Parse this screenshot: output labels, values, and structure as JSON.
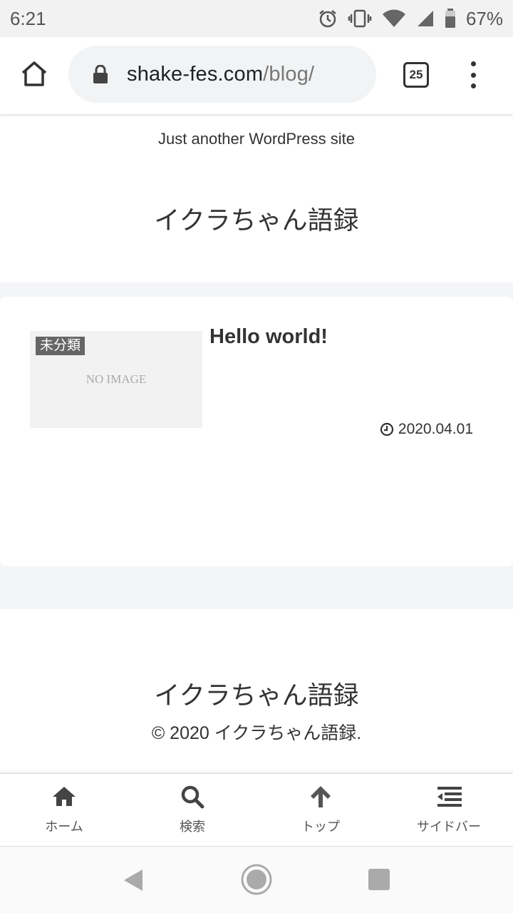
{
  "status_bar": {
    "time": "6:21",
    "battery": "67%"
  },
  "browser": {
    "url_host": "shake-fes.com",
    "url_path": "/blog/",
    "tab_count": "25"
  },
  "site": {
    "tagline": "Just another WordPress site",
    "title": "イクラちゃん語録"
  },
  "post": {
    "category": "未分類",
    "thumbnail_placeholder": "NO IMAGE",
    "title": "Hello world!",
    "date": "2020.04.01"
  },
  "footer": {
    "title": "イクラちゃん語録",
    "copyright": "© 2020 イクラちゃん語録."
  },
  "bottom_nav": {
    "home": "ホーム",
    "search": "検索",
    "top": "トップ",
    "sidebar": "サイドバー"
  }
}
